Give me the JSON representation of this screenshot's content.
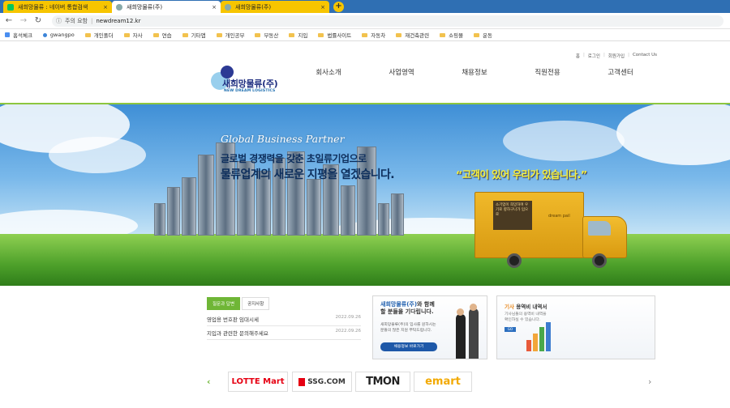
{
  "browser": {
    "tabs": [
      {
        "label": "새희망물류 : 네이버 통합검색",
        "active": false
      },
      {
        "label": "새희망물류(주)",
        "active": true
      },
      {
        "label": "새희망물류(주)",
        "active": false
      }
    ],
    "new_tab_label": "+",
    "close_glyph": "×",
    "security_label": "주의 요함",
    "url": "newdream12.kr",
    "bookmarks": [
      "홈석체크",
      "gwangpo",
      "개인폴더",
      "자사",
      "연습",
      "기타앱",
      "개인공부",
      "부동산",
      "지입",
      "법률사이트",
      "자동차",
      "재건축관련",
      "쇼핑몰",
      "운동"
    ]
  },
  "site": {
    "util_links": [
      "홈",
      "로그인",
      "회원가입",
      "Contact Us"
    ],
    "logo_name": "새희망물류(주)",
    "logo_en": "NEW DREAM LOGISTICS",
    "menu": [
      "회사소개",
      "사업영역",
      "채용정보",
      "직원전용",
      "고객센터"
    ],
    "hero": {
      "script": "Global Business Partner",
      "line1": "글로벌 경쟁력을 갖춘 초일류기업으로",
      "line2": "물류업계의 새로운 지평을 열겠습니다.",
      "slogan": "“고객이 있어 우리가 있습니다.”",
      "truck_sign": "소기업이 희망하며 우기로 향하구나가 입으로",
      "truck_brand": "dream pail"
    },
    "board": {
      "tabs": [
        "질문과 답변",
        "공지사항"
      ],
      "items": [
        {
          "title": "영업용 번호판 임대시세",
          "date": "2022.09.26"
        },
        {
          "title": "지입과 관련한 문의해주세요",
          "date": "2022.09.26"
        }
      ]
    },
    "recruit": {
      "title_brand": "새희망물류(주)",
      "title_rest": "와 함께",
      "title_line2": "할 분들을 기다립니다.",
      "desc1": "새희망물류(주)의 입사를 원하시는",
      "desc2": "분들의 많은 지원 부탁드립니다.",
      "button": "채용정보 바로가기"
    },
    "driver": {
      "title_brand": "기사",
      "title_rest": " 용역비 내역서",
      "desc1": "기사님들의 용역비 내역을",
      "desc2": "확인하실 수 있습니다.",
      "button": "GO"
    },
    "partners": [
      "LOTTE Mart",
      "SSG.COM",
      "TMON",
      "emart"
    ],
    "prev_glyph": "‹",
    "next_glyph": "›"
  },
  "colors": {
    "accent_green": "#6fb636",
    "brand_navy": "#1f2e80",
    "tab_strip": "#2f6fb3"
  }
}
